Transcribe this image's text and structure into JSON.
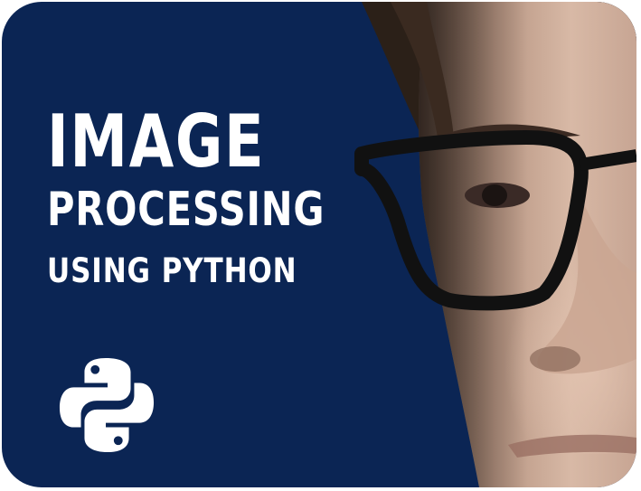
{
  "banner": {
    "title_line1": "IMAGE",
    "title_line2": "PROCESSING",
    "title_line3": "USING PYTHON",
    "logo_icon": "python-logo-icon",
    "photo_icon": "person-with-glasses-photo",
    "colors": {
      "background": "#0b2554",
      "text": "#ffffff",
      "logo": "#ffffff"
    }
  }
}
